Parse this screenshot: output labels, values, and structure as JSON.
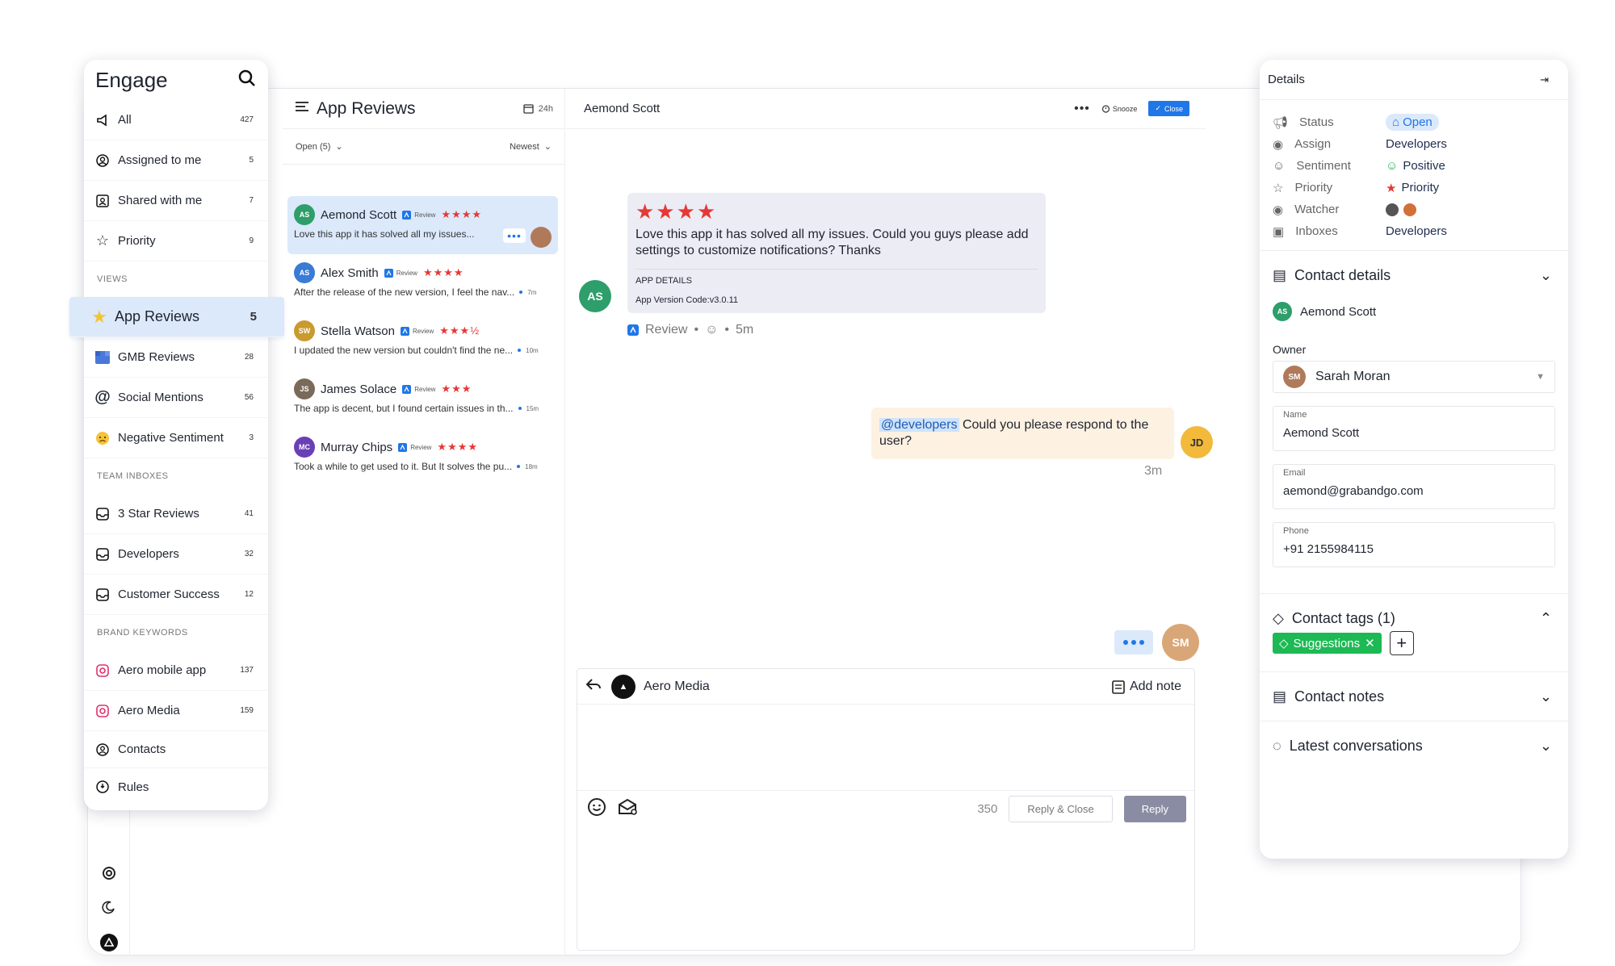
{
  "nav": {
    "title": "Engage",
    "items": [
      {
        "label": "All",
        "count": "427"
      },
      {
        "label": "Assigned to me",
        "count": "5"
      },
      {
        "label": "Shared with me",
        "count": "7"
      },
      {
        "label": "Priority",
        "count": "9"
      }
    ],
    "views_label": "VIEWS",
    "views": [
      {
        "label": "App Reviews",
        "count": "5"
      },
      {
        "label": "GMB Reviews",
        "count": "28"
      },
      {
        "label": "Social Mentions",
        "count": "56"
      },
      {
        "label": "Negative Sentiment",
        "count": "3"
      }
    ],
    "team_label": "TEAM INBOXES",
    "team": [
      {
        "label": "3 Star Reviews",
        "count": "41"
      },
      {
        "label": "Developers",
        "count": "32"
      },
      {
        "label": "Customer Success",
        "count": "12"
      }
    ],
    "brand_label": "BRAND KEYWORDS",
    "brand": [
      {
        "label": "Aero mobile app",
        "count": "137"
      },
      {
        "label": "Aero Media",
        "count": "159"
      }
    ],
    "footer": [
      {
        "label": "Contacts"
      },
      {
        "label": "Rules"
      }
    ]
  },
  "list": {
    "title": "App Reviews",
    "range": "24h",
    "filter": "Open (5)",
    "sort": "Newest",
    "conversations": [
      {
        "name": "Aemond Scott",
        "source": "Review",
        "stars": "★★★★",
        "snippet": "Love this app it has solved all my issues...",
        "time": "",
        "avatar_color": "#2e9e6b",
        "initials": "AS"
      },
      {
        "name": "Alex Smith",
        "source": "Review",
        "stars": "★★★★",
        "snippet": "After the release of the new version, I feel the nav...",
        "time": "7m",
        "avatar_color": "#3a7bd5",
        "initials": "AS"
      },
      {
        "name": "Stella Watson",
        "source": "Review",
        "stars": "★★★½",
        "snippet": "I updated the new version but couldn't find the ne...",
        "time": "10m",
        "avatar_color": "#c99a2e",
        "initials": "SW"
      },
      {
        "name": "James Solace",
        "source": "Review",
        "stars": "★★★",
        "snippet": "The app is decent, but I found certain issues in th...",
        "time": "15m",
        "avatar_color": "#7a6a5a",
        "initials": "JS"
      },
      {
        "name": "Murray Chips",
        "source": "Review",
        "stars": "★★★★",
        "snippet": "Took a while to get used to it. But It solves the pu...",
        "time": "18m",
        "avatar_color": "#6a3fb5",
        "initials": "MC"
      }
    ]
  },
  "chat": {
    "title": "Aemond Scott",
    "snooze": "Snooze",
    "close": "Close",
    "review_stars": "★★★★",
    "review_text": "Love this app it has solved all my issues. Could you guys please add settings to customize notifications? Thanks",
    "app_details_label": "APP DETAILS",
    "app_version": "App Version Code:v3.0.11",
    "review_source": "Review",
    "review_time": "5m",
    "note_mention": "@developers",
    "note_text": " Could you please respond to the user?",
    "note_time": "3m",
    "composer_from": "Aero Media",
    "add_note": "Add note",
    "char_count": "350",
    "reply_close": "Reply & Close",
    "reply": "Reply"
  },
  "details": {
    "title": "Details",
    "props": [
      {
        "label": "Status",
        "value": "Open"
      },
      {
        "label": "Assign",
        "value": "Developers"
      },
      {
        "label": "Sentiment",
        "value": "Positive"
      },
      {
        "label": "Priority",
        "value": "Priority"
      },
      {
        "label": "Watcher",
        "value": ""
      },
      {
        "label": "Inboxes",
        "value": "Developers"
      }
    ],
    "contact_details": "Contact details",
    "contact_name": "Aemond Scott",
    "owner_label": "Owner",
    "owner": "Sarah Moran",
    "name_label": "Name",
    "name_value": "Aemond Scott",
    "email_label": "Email",
    "email_value": "aemond@grabandgo.com",
    "phone_label": "Phone",
    "phone_value": "+91 2155984115",
    "tags_title": "Contact tags (1)",
    "tag": "Suggestions",
    "notes_title": "Contact notes",
    "latest_title": "Latest conversations"
  },
  "colors": {
    "accent": "#1f77e8",
    "selected_bg": "#dbe9fb",
    "star": "#e53935",
    "tag_green": "#1db954",
    "note_bg": "#fdf1e2"
  }
}
